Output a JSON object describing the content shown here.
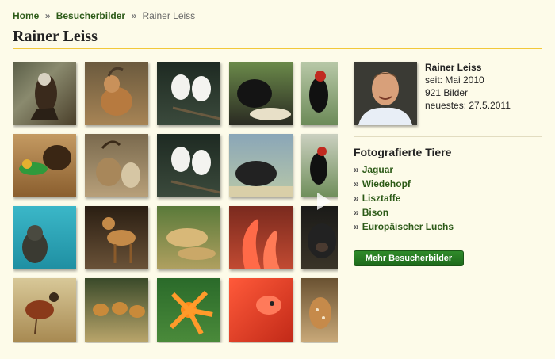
{
  "breadcrumb": {
    "home": "Home",
    "sep": "»",
    "section": "Besucherbilder",
    "current": "Rainer Leiss"
  },
  "page_title": "Rainer Leiss",
  "profile": {
    "name": "Rainer Leiss",
    "since": "seit: Mai 2010",
    "count": "921 Bilder",
    "latest": "neuestes: 27.5.2011"
  },
  "animals": {
    "title": "Fotografierte Tiere",
    "bullet": "»",
    "items": [
      "Jaguar",
      "Wiedehopf",
      "Lisztaffe",
      "Bison",
      "Europäischer Luchs"
    ]
  },
  "more_button": "Mehr Besucherbilder",
  "colors": {
    "link_green": "#2c5a17",
    "accent_yellow": "#f2c83a",
    "button_green": "#1e6a1b",
    "background": "#fdfbe9"
  }
}
